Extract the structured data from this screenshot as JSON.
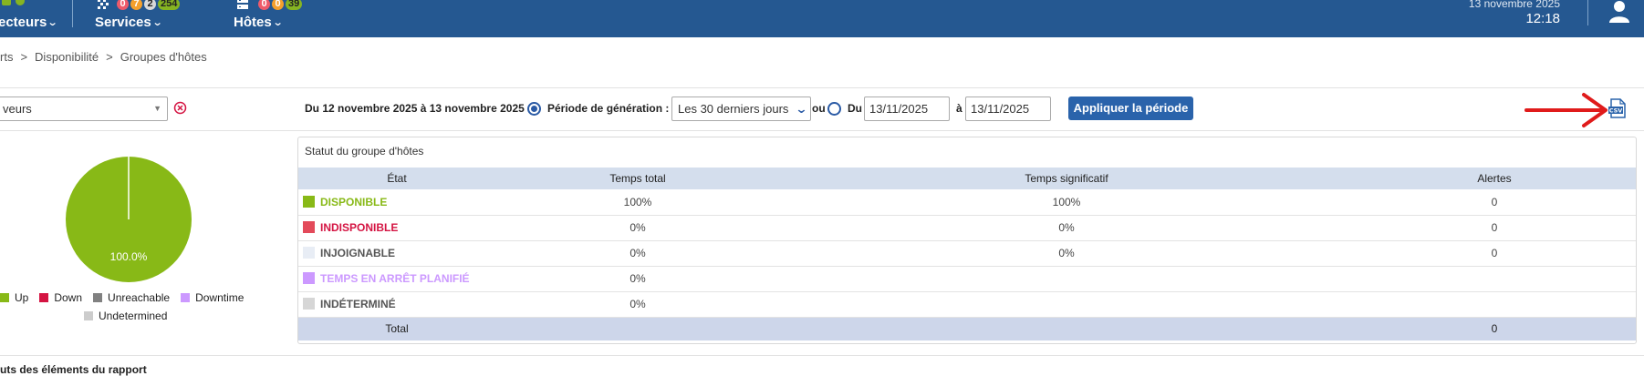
{
  "topbar": {
    "pollers_label": "ecteurs",
    "services_label": "Services",
    "hosts_label": "Hôtes",
    "service_badges": [
      "0",
      "7",
      "2",
      "254"
    ],
    "host_badges": [
      "0",
      "0",
      "39"
    ],
    "date": "13 novembre 2025",
    "time": "12:18"
  },
  "breadcrumb": {
    "items": [
      "rts",
      "Disponibilité",
      "Groupes d'hôtes"
    ],
    "separator": ">"
  },
  "filters": {
    "hostgroup_value": "veurs",
    "period_range": "Du 12 novembre 2025 à 13 novembre 2025",
    "period_label": "Période de génération :",
    "period_value": "Les 30 derniers jours",
    "or_label": "ou",
    "from_label": "Du",
    "from_date": "13/11/2025",
    "to_label": "à",
    "to_date": "13/11/2025",
    "apply_label": "Appliquer la période",
    "export_icon": "csv-icon"
  },
  "pie": {
    "label": "100.0%",
    "legend": [
      {
        "name": "Up",
        "color": "#88b917"
      },
      {
        "name": "Down",
        "color": "#d41442"
      },
      {
        "name": "Unreachable",
        "color": "#818181"
      },
      {
        "name": "Downtime",
        "color": "#cc99ff"
      },
      {
        "name": "Undetermined",
        "color": "#cccccc"
      }
    ]
  },
  "status_table": {
    "title": "Statut du groupe d'hôtes",
    "headers": [
      "État",
      "Temps total",
      "Temps significatif",
      "Alertes"
    ],
    "rows": [
      {
        "state": "DISPONIBLE",
        "color": "#88b917",
        "total": "100%",
        "significant": "100%",
        "alerts": "0"
      },
      {
        "state": "INDISPONIBLE",
        "color": "#e34a5a",
        "text_color": "#d41442",
        "total": "0%",
        "significant": "0%",
        "alerts": "0"
      },
      {
        "state": "INJOIGNABLE",
        "color": "#e8edf5",
        "text_color": "#555555",
        "total": "0%",
        "significant": "0%",
        "alerts": "0"
      },
      {
        "state": "TEMPS EN ARRÊT PLANIFIÉ",
        "color": "#cc99ff",
        "text_color": "#cc99ff",
        "total": "0%",
        "significant": "",
        "alerts": ""
      },
      {
        "state": "INDÉTERMINÉ",
        "color": "#d6d6d6",
        "text_color": "#555555",
        "total": "0%",
        "significant": "",
        "alerts": ""
      }
    ],
    "total_label": "Total",
    "total_alerts": "0"
  },
  "footer": {
    "section_title": "uts des éléments du rapport"
  }
}
